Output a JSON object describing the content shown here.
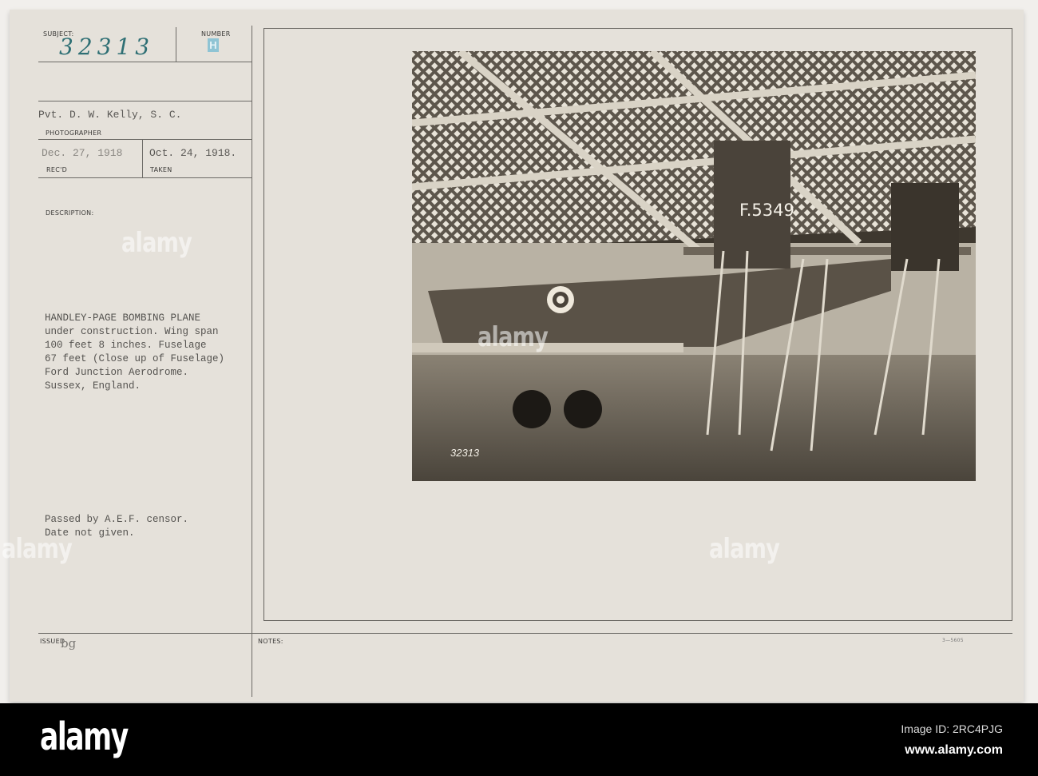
{
  "card": {
    "subject_label": "SUBJECT:",
    "subject_value": "32313",
    "number_label": "NUMBER",
    "number_value": "H",
    "photographer": "Pvt. D. W. Kelly, S. C.",
    "photographer_label": "PHOTOGRAPHER",
    "received_date": "Dec. 27, 1918",
    "received_label": "REC'D",
    "taken_date": "Oct. 24, 1918.",
    "taken_label": "TAKEN",
    "description_label": "DESCRIPTION:",
    "description_lines": [
      "HANDLEY-PAGE BOMBING PLANE",
      "under construction. Wing span",
      "100 feet 8 inches. Fuselage",
      "67 feet (Close up of Fuselage)",
      "Ford Junction Aerodrome.",
      "Sussex, England."
    ],
    "censor_lines": [
      "Passed by A.E.F. censor.",
      "Date not given."
    ],
    "issued_label": "ISSUED",
    "issued_value": "bg",
    "notes_label": "NOTES:",
    "form_number": "3—5605"
  },
  "photo": {
    "tail_marking": "F.5349",
    "negative_number": "32313"
  },
  "watermark": "alamy",
  "footer": {
    "logo": "alamy",
    "image_id": "Image ID: 2RC4PJG",
    "url": "www.alamy.com"
  },
  "colors": {
    "ink_handwritten": "#2e6f74",
    "number_stamp": "#8fc4d4",
    "footer_bg": "#000000"
  }
}
